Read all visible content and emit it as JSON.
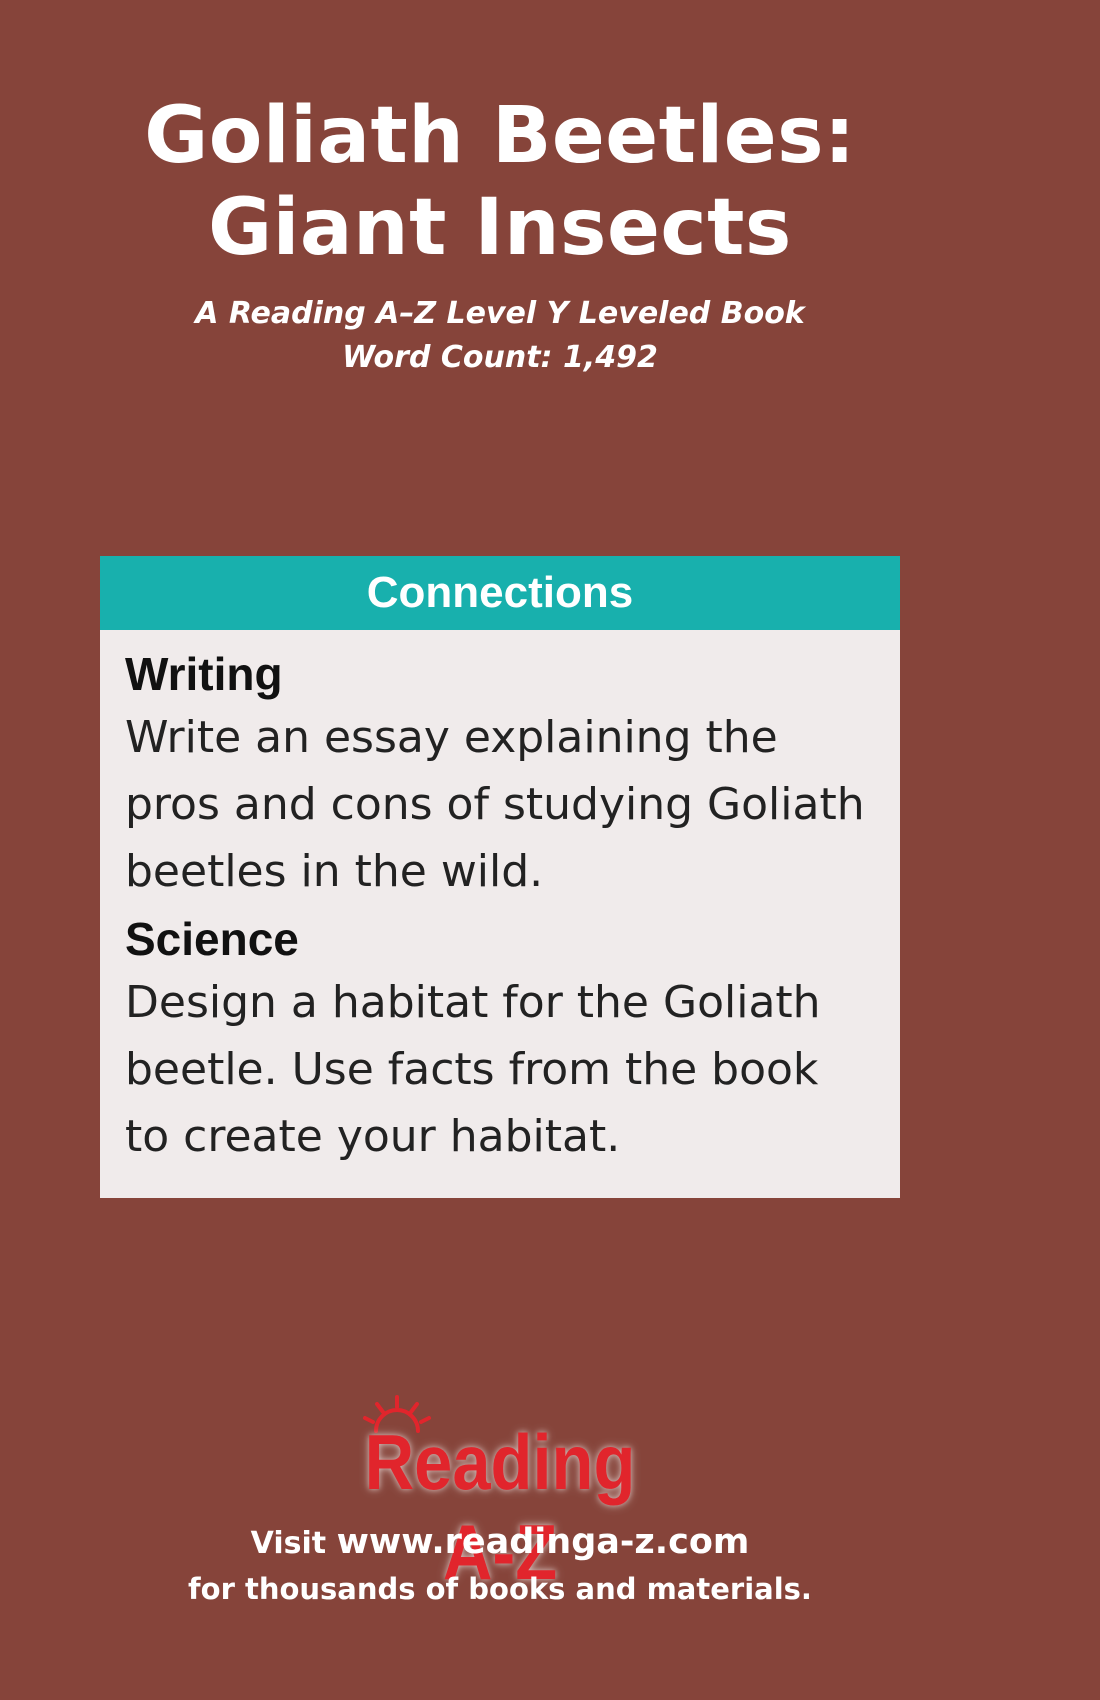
{
  "cover": {
    "title_line1": "Goliath Beetles:",
    "title_line2": "Giant Insects",
    "subtitle_line1": "A Reading A–Z Level Y Leveled Book",
    "subtitle_line2": "Word Count: 1,492"
  },
  "connections": {
    "heading": "Connections",
    "sections": [
      {
        "heading": "Writing",
        "text": "Write an essay explaining the pros and cons of studying Goliath beetles in the wild."
      },
      {
        "heading": "Science",
        "text": "Design a habitat for the Goliath beetle. Use facts from the book to create your habitat."
      }
    ]
  },
  "logo": {
    "text": "Reading A-Z",
    "icon": "sun-icon",
    "color": "#e1252c"
  },
  "footer": {
    "visit_label": "Visit",
    "url": "www.readinga-z.com",
    "line2": "for thousands of books and materials."
  },
  "colors": {
    "background": "#86443a",
    "panel_header": "#18b0ad",
    "panel_body": "#f0ebeb"
  }
}
